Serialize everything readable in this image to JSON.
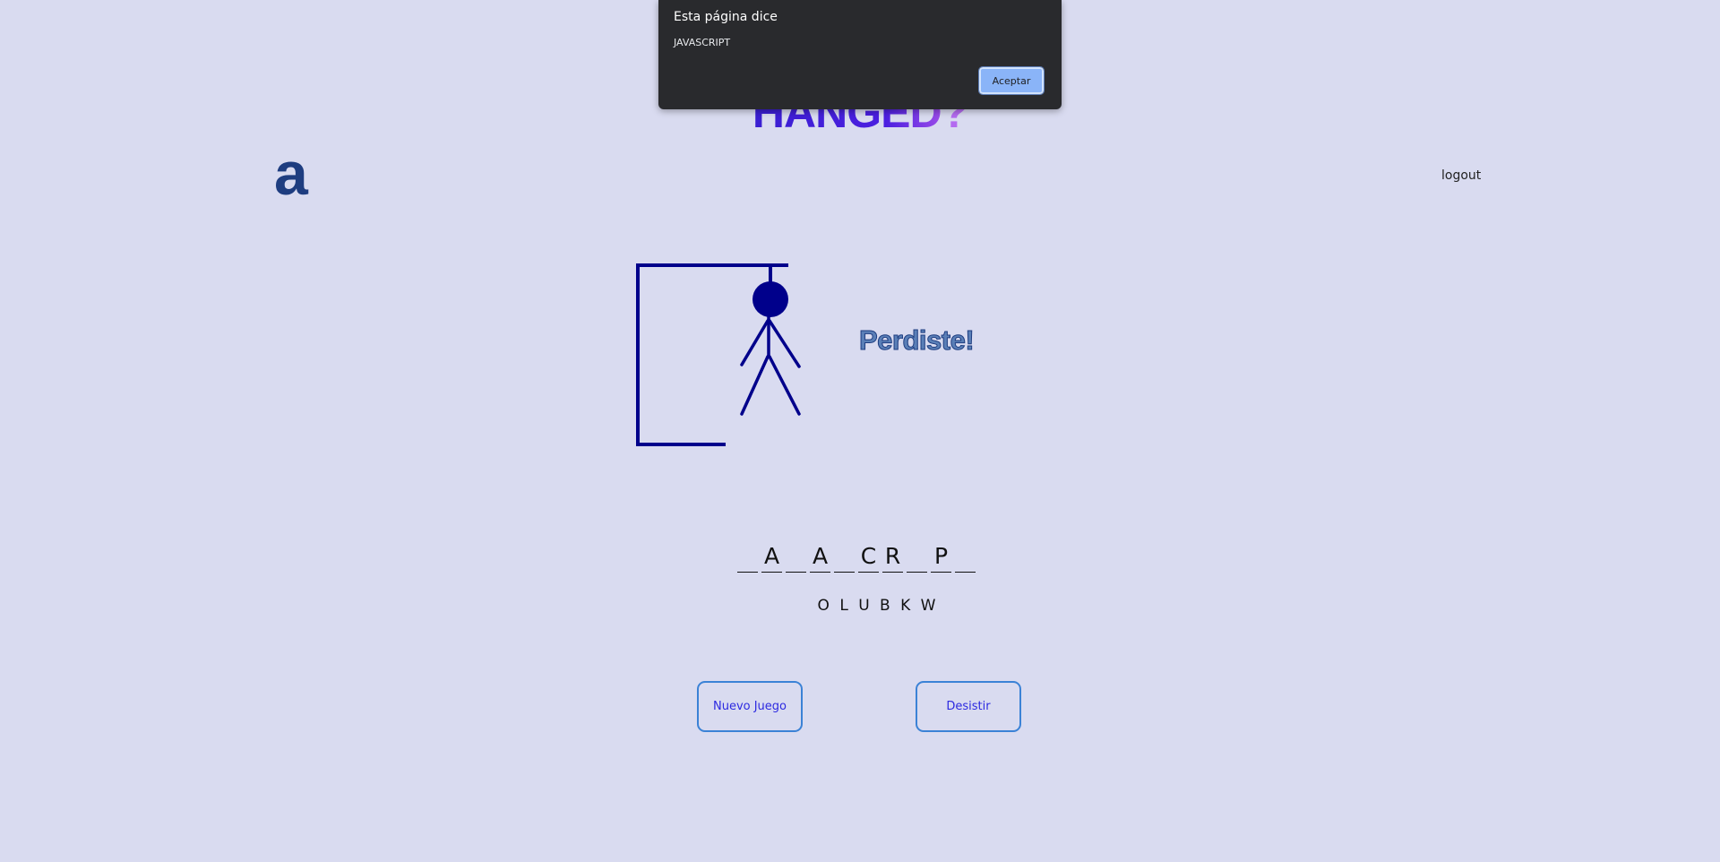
{
  "page": {
    "title_main": "HANGED",
    "title_mark": "?",
    "logo": "a",
    "logout_label": "logout"
  },
  "game": {
    "status": "Perdiste!",
    "word_slots": [
      "",
      "A",
      "",
      "A",
      "",
      "C",
      "R",
      "",
      "P",
      ""
    ],
    "missed_letters": "O L U B K W"
  },
  "buttons": {
    "new_game_label": "Nuevo Juego",
    "quit_label": "Desistir"
  },
  "dialog": {
    "title": "Esta página dice",
    "message": "JAVASCRIPT",
    "ok_label": "Aceptar"
  },
  "colors": {
    "background": "#d9dbf0",
    "hangman": "#00008b",
    "accent_button": "#3b82d6",
    "dialog_bg": "#292a2d"
  }
}
